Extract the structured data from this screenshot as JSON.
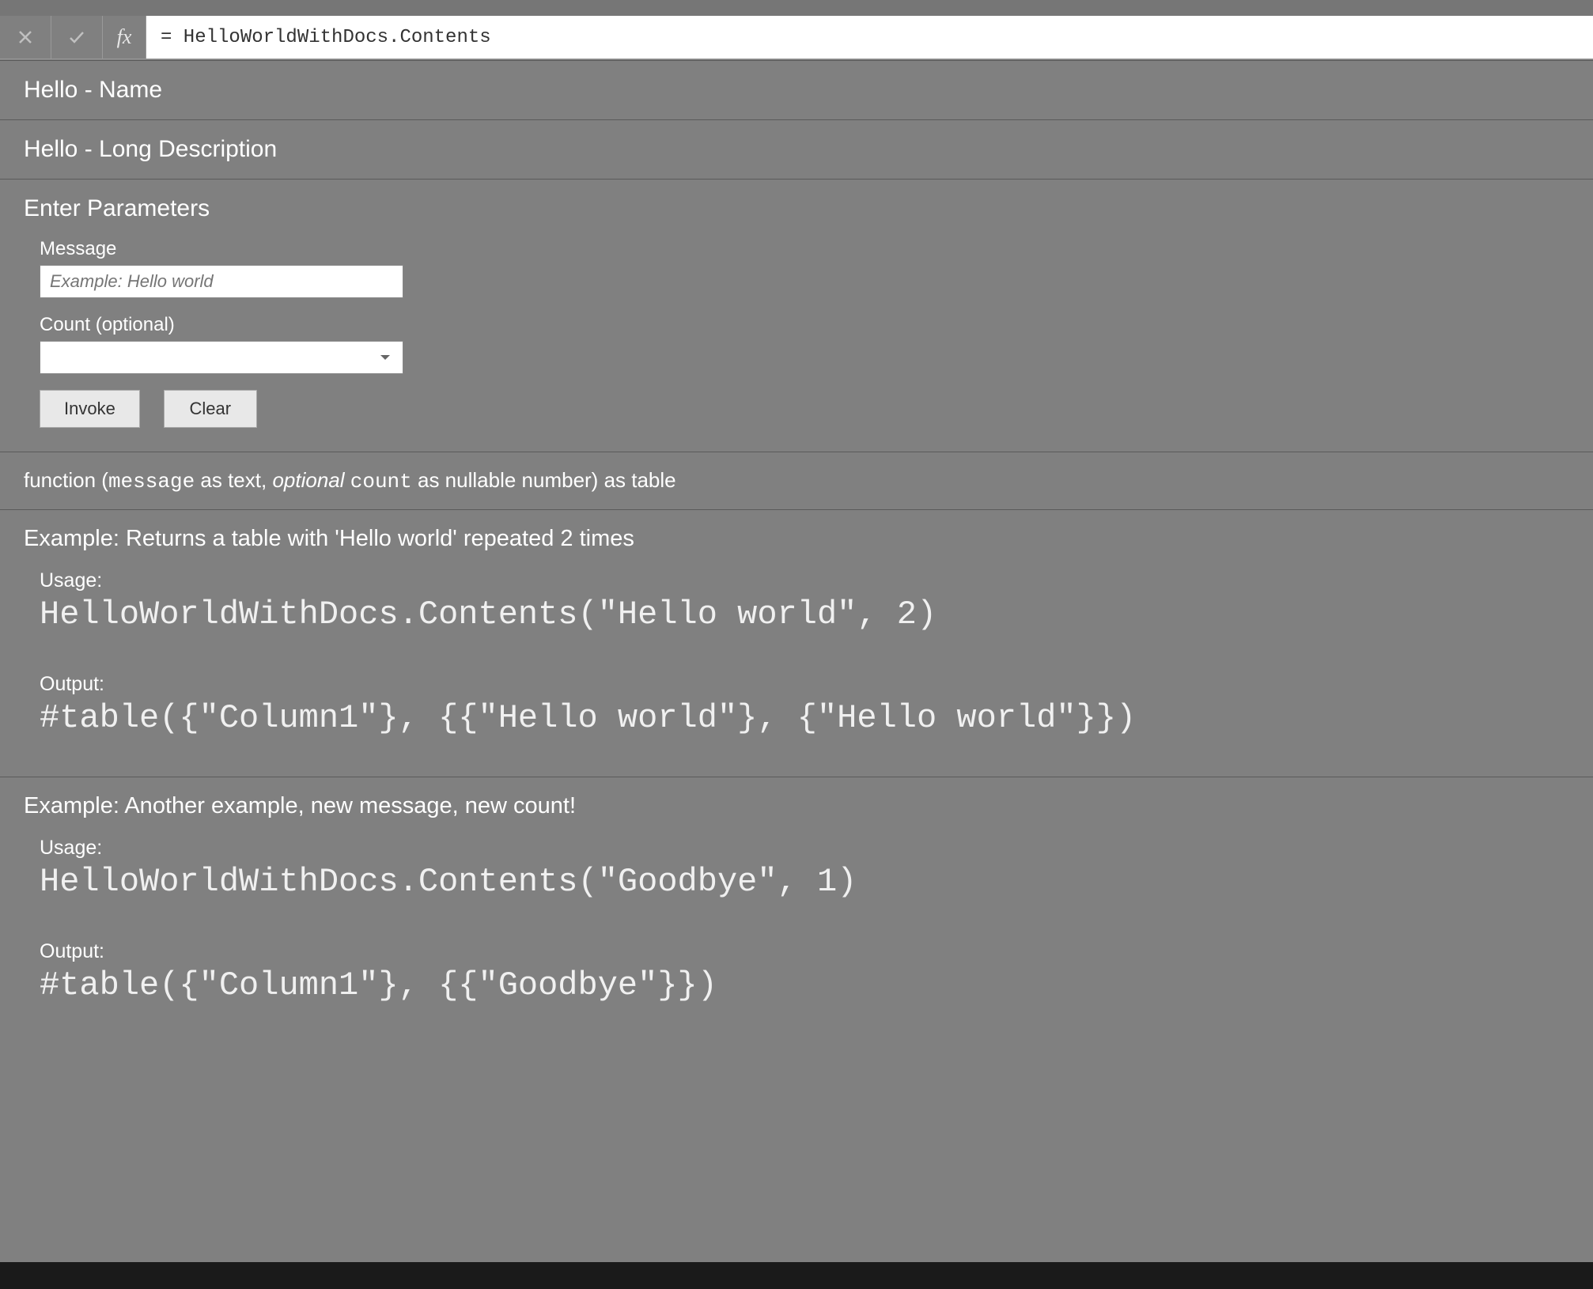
{
  "formulaBar": {
    "formula": "= HelloWorldWithDocs.Contents"
  },
  "sections": {
    "name": "Hello - Name",
    "description": "Hello - Long Description"
  },
  "parameters": {
    "title": "Enter Parameters",
    "message": {
      "label": "Message",
      "placeholder": "Example: Hello world",
      "value": ""
    },
    "count": {
      "label": "Count (optional)",
      "value": ""
    },
    "buttons": {
      "invoke": "Invoke",
      "clear": "Clear"
    }
  },
  "signature": {
    "prefix": "function (",
    "param1": "message",
    "asText": " as text, ",
    "optional": "optional ",
    "param2": "count",
    "suffix": " as nullable number) as table"
  },
  "examples": [
    {
      "title": "Example: Returns a table with 'Hello world' repeated 2 times",
      "usageLabel": "Usage:",
      "usage": "HelloWorldWithDocs.Contents(\"Hello world\", 2)",
      "outputLabel": "Output:",
      "output": "#table({\"Column1\"}, {{\"Hello world\"}, {\"Hello world\"}})"
    },
    {
      "title": "Example: Another example, new message, new count!",
      "usageLabel": "Usage:",
      "usage": "HelloWorldWithDocs.Contents(\"Goodbye\", 1)",
      "outputLabel": "Output:",
      "output": "#table({\"Column1\"}, {{\"Goodbye\"}})"
    }
  ]
}
